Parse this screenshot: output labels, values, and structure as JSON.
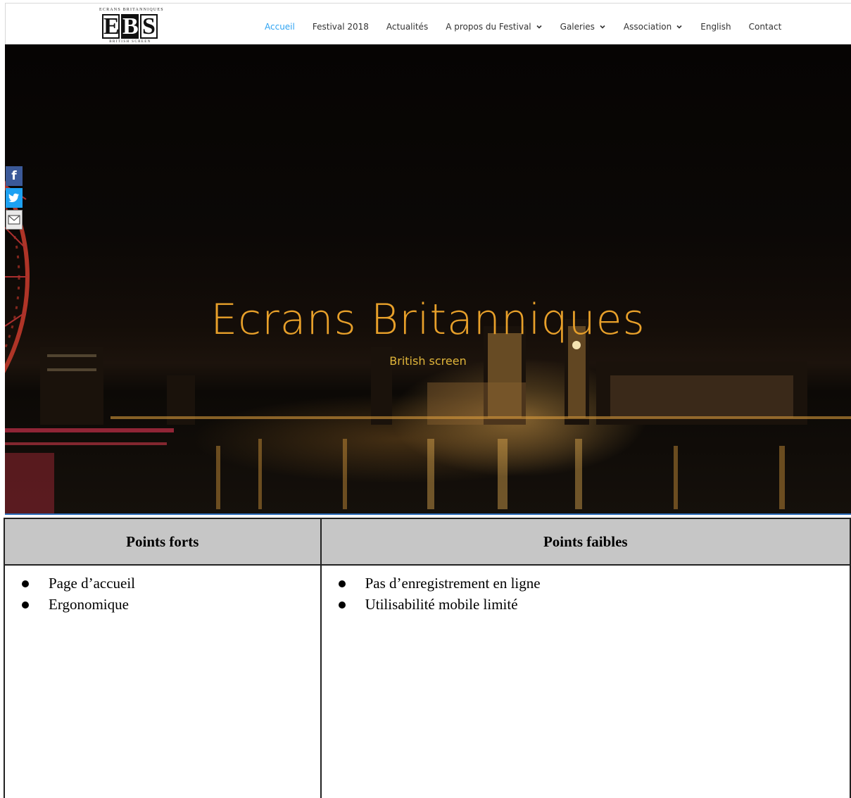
{
  "logo": {
    "top_text": "ECRANS BRITANNIQUES",
    "letters": [
      "E",
      "B",
      "S"
    ],
    "bottom_text": "BRITISH SCREEN"
  },
  "nav": {
    "items": [
      {
        "label": "Accueil",
        "active": true,
        "dropdown": false
      },
      {
        "label": "Festival 2018",
        "active": false,
        "dropdown": false
      },
      {
        "label": "Actualités",
        "active": false,
        "dropdown": false
      },
      {
        "label": "A propos du Festival",
        "active": false,
        "dropdown": true
      },
      {
        "label": "Galeries",
        "active": false,
        "dropdown": true
      },
      {
        "label": "Association",
        "active": false,
        "dropdown": true
      },
      {
        "label": "English",
        "active": false,
        "dropdown": false
      },
      {
        "label": "Contact",
        "active": false,
        "dropdown": false
      }
    ],
    "active_color": "#2ea3f2"
  },
  "share": {
    "facebook_icon": "facebook-icon",
    "twitter_icon": "twitter-icon",
    "email_icon": "mail-icon"
  },
  "hero": {
    "title": "Ecrans Britanniques",
    "subtitle": "British screen",
    "title_color": "#e8a02a",
    "scroll_icon": "chevron-down-icon"
  },
  "table": {
    "col1_header": "Points forts",
    "col2_header": "Points faibles",
    "col1_items": [
      "Page d’accueil",
      "Ergonomique"
    ],
    "col2_items": [
      "Pas d’enregistrement en ligne",
      "Utilisabilité mobile limité"
    ]
  }
}
